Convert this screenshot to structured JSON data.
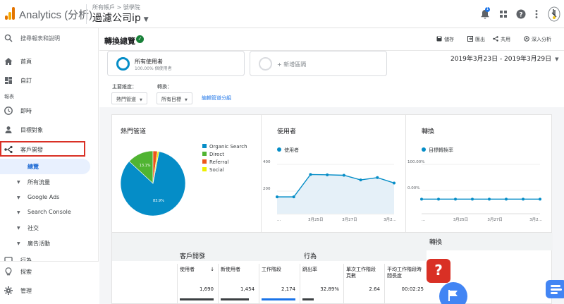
{
  "app": {
    "title": "Analytics (分析)",
    "breadcrumb": "所有帳戶 > 號學院",
    "view": "過濾公司ip"
  },
  "topbar": {
    "notification_count": "1",
    "icons": [
      "notification-icon",
      "apps-icon",
      "help-icon",
      "more-icon",
      "avatar"
    ]
  },
  "sidebar": {
    "search_placeholder": "搜尋報表和說明",
    "home": "首頁",
    "custom": "自訂",
    "reports_section": "報表",
    "realtime": "即時",
    "audience": "目標對象",
    "acquisition": "客戶開發",
    "overview": "總覽",
    "sub": [
      "所有流量",
      "Google Ads",
      "Search Console",
      "社交",
      "廣告活動"
    ],
    "behavior": "行為",
    "discover": "探索",
    "admin": "管理"
  },
  "header": {
    "title": "轉換總覽",
    "actions": {
      "save": "儲存",
      "export": "匯出",
      "share": "共用",
      "insights": "深入分析"
    }
  },
  "segments": {
    "all_users_name": "所有使用者",
    "all_users_pct": "100.00% 個使用者",
    "add_segment": "+ 新增區隔"
  },
  "date_range": "2019年3月23日 - 2019年3月29日",
  "dimension": {
    "primary_label": "主要維度：",
    "primary_value": "熱門管道",
    "conversion_label": "轉換：",
    "conversion_value": "所有目標",
    "edit_link": "編輯管道分組"
  },
  "colors": {
    "organic": "#058dc7",
    "direct": "#50b432",
    "referral": "#ed561b",
    "social": "#edef00",
    "accent": "#1a73e8",
    "alert": "#d93025"
  },
  "cards": {
    "channels_title": "熱門管道",
    "users_title": "使用者",
    "users_series": "使用者",
    "conversions_title": "轉換",
    "conversions_series": "目標轉換率"
  },
  "chart_data": [
    {
      "type": "pie",
      "title": "熱門管道",
      "categories": [
        "Organic Search",
        "Direct",
        "Referral",
        "Social"
      ],
      "values": [
        83.9,
        13.1,
        2.2,
        0.8
      ],
      "data_labels": [
        "83.9%",
        "13.1%",
        "",
        ""
      ]
    },
    {
      "type": "area",
      "title": "使用者",
      "series": [
        {
          "name": "使用者",
          "values": [
            200,
            200,
            345,
            343,
            340,
            310,
            325,
            290
          ]
        }
      ],
      "x_ticks": [
        "...",
        "3月25日",
        "3月27日",
        "3月2..."
      ],
      "y_ticks": [
        "400",
        "200"
      ],
      "ylim": [
        100,
        420
      ]
    },
    {
      "type": "line",
      "title": "轉換",
      "series": [
        {
          "name": "目標轉換率",
          "values": [
            0,
            0,
            0,
            0,
            0,
            0,
            0,
            0
          ]
        }
      ],
      "x_ticks": [
        "...",
        "3月25日",
        "3月27日",
        "3月2..."
      ],
      "y_ticks": [
        "100.00%",
        "0.00%"
      ],
      "ylim": [
        -40,
        110
      ]
    }
  ],
  "table": {
    "group1": "客戶開發",
    "group2": "行為",
    "group3": "轉換",
    "columns": [
      "使用者",
      "新使用者",
      "工作階段",
      "跳出率",
      "單次工作階段頁數",
      "平均工作階段時間長度"
    ],
    "values": [
      "1,690",
      "1,454",
      "2,174",
      "32.89%",
      "2.64",
      "00:02:25"
    ],
    "sort_marker": "↓"
  }
}
